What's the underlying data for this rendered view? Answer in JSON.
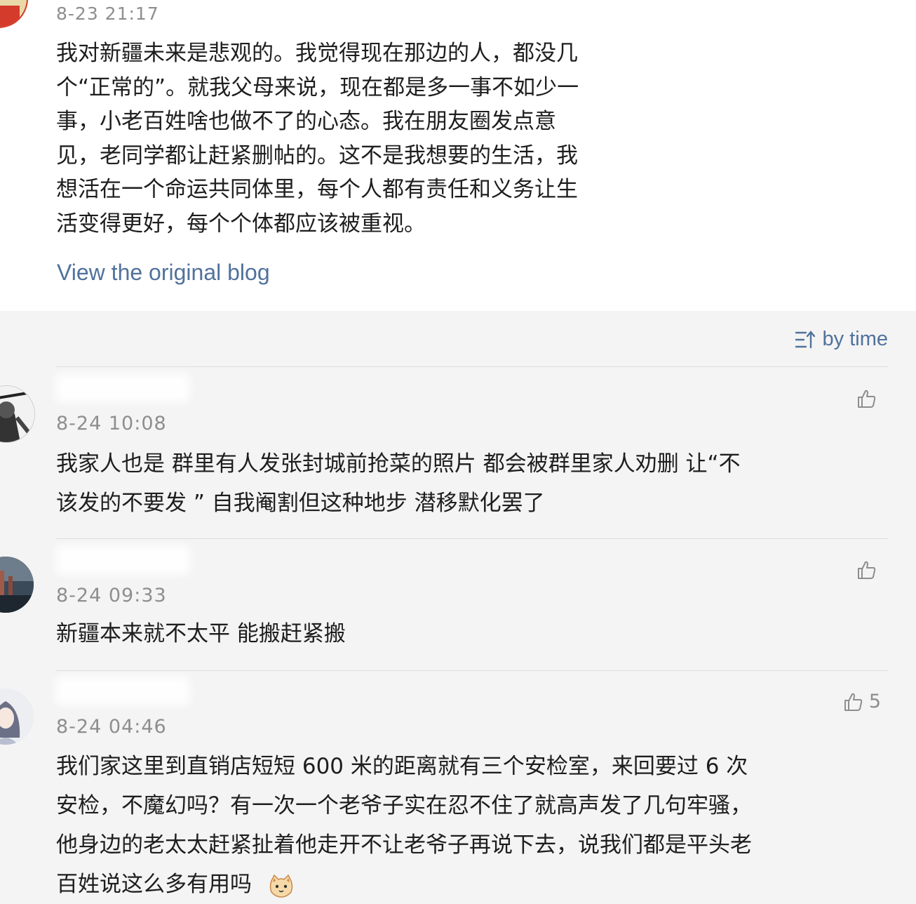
{
  "post": {
    "time": "8-23 21:17",
    "text_lines": [
      "我对新疆未来是悲观的。我觉得现在那边的人，都没几",
      "个“正常的”。就我父母来说，现在都是多一事不如少一",
      "事，小老百姓啥也做不了的心态。我在朋友圈发点意",
      "见，老同学都让赶紧删帖的。这不是我想要的生活，我",
      "想活在一个命运共同体里，每个人都有责任和义务让生",
      "活变得更好，每个个体都应该被重视。"
    ],
    "view_link": "View the original blog"
  },
  "sort": {
    "label": "by time",
    "icon": "sort-icon"
  },
  "comments": [
    {
      "time": "8-24 10:08",
      "text_lines": [
        "我家人也是  群里有人发张封城前抢菜的照片 都会被群里家人劝删 让“不",
        "该发的不要发 ” 自我阉割但这种地步  潜移默化罢了"
      ],
      "likes": ""
    },
    {
      "time": "8-24 09:33",
      "text_lines": [
        "新疆本来就不太平 能搬赶紧搬"
      ],
      "likes": ""
    },
    {
      "time": "8-24 04:46",
      "text_lines": [
        "我们家这里到直销店短短 600 米的距离就有三个安检室，来回要过 6 次",
        "安检，不魔幻吗？有一次一个老爷子实在忍不住了就高声发了几句牢骚，",
        "他身边的老太太赶紧扯着他走开不让老爷子再说下去，说我们都是平头老",
        "百姓说这么多有用吗"
      ],
      "likes": "5",
      "emoji": "cat-face-emoji"
    }
  ],
  "colors": {
    "link": "#50729c",
    "muted": "#8e8e8e",
    "text": "#1e1e1e",
    "background": "#f4f4f4"
  }
}
